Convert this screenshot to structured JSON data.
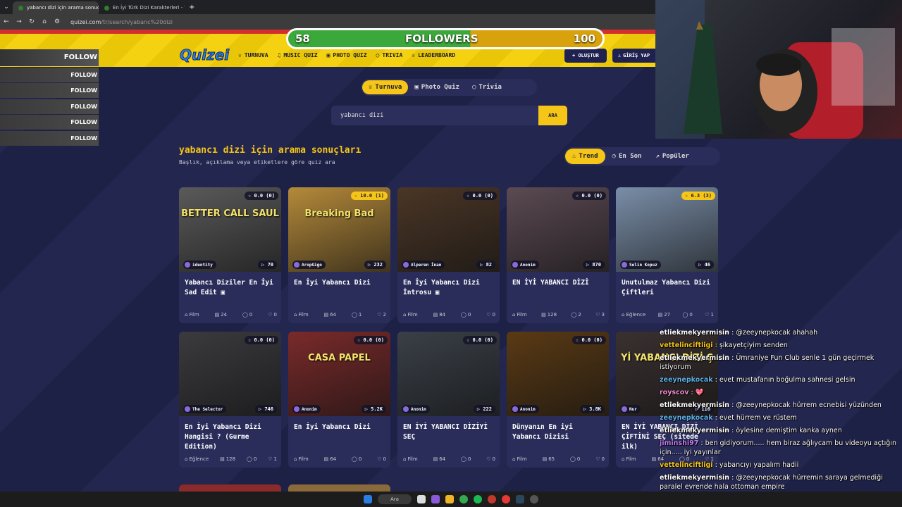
{
  "browser": {
    "tabs": [
      {
        "label": "yabancı dizi için arama sonuçla",
        "active": true
      },
      {
        "label": "En İyi Türk Dizi Karakterleri - Tier",
        "active": false
      }
    ],
    "new_tab": "+",
    "url_domain": "quizei.com",
    "url_path": "/tr/search/yabanc%20dizi"
  },
  "site": {
    "logo": "Quizei",
    "nav": [
      {
        "icon": "trophy-icon",
        "label": "TURNUVA"
      },
      {
        "icon": "music-icon",
        "label": "MUSIC QUIZ"
      },
      {
        "icon": "photo-icon",
        "label": "PHOTO QUIZ"
      },
      {
        "icon": "chat-icon",
        "label": "TRIVIA"
      },
      {
        "icon": "trophy-icon",
        "label": "LEADERBOARD"
      }
    ],
    "create_button": "+ OLUŞTUR",
    "login_button": "GİRİŞ YAP"
  },
  "followers_goal": {
    "current": "58",
    "label": "FOLLOWERS",
    "target": "100",
    "progress": 0.58
  },
  "follow_list": [
    "FOLLOW",
    "FOLLOW",
    "FOLLOW",
    "FOLLOW",
    "FOLLOW",
    "FOLLOW"
  ],
  "filter_tabs": [
    {
      "icon": "trophy-icon",
      "label": "Turnuva",
      "active": true
    },
    {
      "icon": "camera-icon",
      "label": "Photo Quiz",
      "active": false
    },
    {
      "icon": "chat-icon",
      "label": "Trivia",
      "active": false
    }
  ],
  "search": {
    "value": "yabancı dizi",
    "button": "ARA"
  },
  "results": {
    "title": "yabancı dizi için arama sonuçları",
    "subtitle": "Başlık, açıklama veya etiketlere göre quiz ara"
  },
  "sort_tabs": [
    {
      "label": "Trend",
      "active": true
    },
    {
      "label": "En Son",
      "active": false
    },
    {
      "label": "Popüler",
      "active": false
    }
  ],
  "cards": [
    {
      "rating": "0.0 (0)",
      "author": "identity",
      "plays": "70",
      "title": "Yabancı Diziler En İyi Sad Edit ▣",
      "category": "Film",
      "questions": "24",
      "comments": "0",
      "likes": "0",
      "thumb_color": "#5a5a5a",
      "thumb_text": "BETTER CALL SAUL"
    },
    {
      "rating": "10.0 (1)",
      "rating_gold": true,
      "author": "AropGigo",
      "plays": "232",
      "title": "En İyi Yabancı Dizi",
      "category": "Film",
      "questions": "64",
      "comments": "1",
      "likes": "2",
      "thumb_color": "#b58a3a",
      "thumb_text": "Breaking Bad"
    },
    {
      "rating": "0.0 (0)",
      "author": "Alperen İnan",
      "plays": "82",
      "title": "En İyi Yabancı Dizi İntrosu ▣",
      "category": "Film",
      "questions": "84",
      "comments": "0",
      "likes": "0",
      "thumb_color": "#4a3626",
      "thumb_text": ""
    },
    {
      "rating": "0.0 (0)",
      "author": "Anonim",
      "plays": "870",
      "title": "EN İYİ YABANCI DİZİ",
      "category": "Film",
      "questions": "128",
      "comments": "2",
      "likes": "3",
      "thumb_color": "#5b4a52",
      "thumb_text": ""
    },
    {
      "rating": "6.3 (3)",
      "rating_gold": true,
      "author": "Selin Kopuz",
      "plays": "46",
      "title": "Unutulmaz Yabancı Dizi Çiftleri",
      "category": "Eğlence",
      "questions": "27",
      "comments": "0",
      "likes": "1",
      "thumb_color": "#7a8ea8",
      "thumb_text": ""
    },
    {
      "rating": "0.0 (0)",
      "author": "The Selector",
      "plays": "746",
      "title": "En İyi Yabancı Dizi Hangisi ? (Gurme Edition)",
      "category": "Eğlence",
      "questions": "128",
      "comments": "0",
      "likes": "1",
      "thumb_color": "#3b3a3e",
      "thumb_text": ""
    },
    {
      "rating": "0.0 (0)",
      "author": "Anonim",
      "plays": "5.2K",
      "title": "En İyi Yabancı Dizi",
      "category": "Film",
      "questions": "64",
      "comments": "0",
      "likes": "0",
      "thumb_color": "#7a2a2a",
      "thumb_text": "CASA PAPEL"
    },
    {
      "rating": "0.0 (0)",
      "author": "Anonim",
      "plays": "222",
      "title": "EN İYİ YABANCI DİZİYİ SEÇ",
      "category": "Film",
      "questions": "64",
      "comments": "0",
      "likes": "0",
      "thumb_color": "#3a4048",
      "thumb_text": ""
    },
    {
      "rating": "0.0 (0)",
      "author": "Anonim",
      "plays": "3.8K",
      "title": "Dünyanın En iyi Yabancı Dizisi",
      "category": "Film",
      "questions": "65",
      "comments": "0",
      "likes": "0",
      "thumb_color": "#5a3a14",
      "thumb_text": ""
    },
    {
      "rating": "",
      "author": "Nur",
      "plays": "116",
      "title": "EN İYİ YABANCI DİZİ ÇİFTİNİ SEÇ (sitede ilk)",
      "category": "Film",
      "questions": "64",
      "comments": "0",
      "likes": "1",
      "thumb_color": "#3a3030",
      "thumb_text": "Yİ YABANCI DİZİ Ç"
    }
  ],
  "chat": [
    {
      "user": "etliekmekyermisin",
      "color": "#ffffff",
      "text": "@zeeynepkocak ahahah"
    },
    {
      "user": "vettelinciftligi",
      "color": "#f5c518",
      "text": "şikayetçiyim senden"
    },
    {
      "user": "etliekmekyermisin",
      "color": "#ffffff",
      "text": "Ümraniye Fun Club senle 1 gün geçirmek istiyorum"
    },
    {
      "user": "zeeynepkocak",
      "color": "#5dade2",
      "text": "evet mustafanın boğulma sahnesi gelsin"
    },
    {
      "user": "royscov",
      "color": "#f08bd0",
      "text": "💖"
    },
    {
      "user": "etliekmekyermisin",
      "color": "#ffffff",
      "text": "@zeeynepkocak hürrem ecnebisi yüzünden"
    },
    {
      "user": "zeeynepkocak",
      "color": "#5dade2",
      "text": "evet hürrem ve rüstem"
    },
    {
      "user": "etliekmekyermisin",
      "color": "#ffffff",
      "text": "öylesine demiştim kanka aynen"
    },
    {
      "user": "jiminshi97",
      "color": "#c07cf5",
      "text": "ben gidiyorum..... hem biraz ağlıycam bu videoyu açtığın için..... iyi yayınlar"
    },
    {
      "user": "vettelinciftligi",
      "color": "#f5c518",
      "text": "yabancıyı yapalım hadii"
    },
    {
      "user": "etliekmekyermisin",
      "color": "#ffffff",
      "text": "@zeeynepkocak hürremin saraya gelmediği paralel evrende hala ottoman empire"
    }
  ],
  "taskbar": {
    "search": "Ara"
  }
}
